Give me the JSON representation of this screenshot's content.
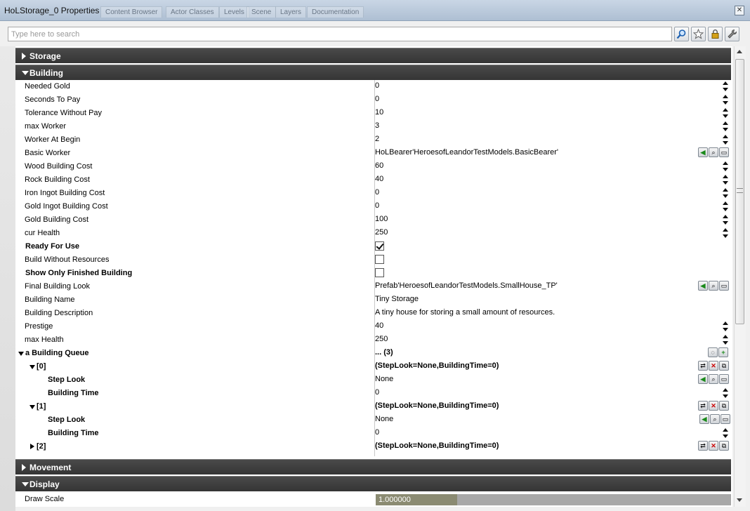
{
  "window": {
    "title": "HoLStorage_0 Properties",
    "background_tabs": [
      "Content Browser",
      "Actor Classes",
      "Levels",
      "Scene",
      "Layers",
      "Documentation"
    ]
  },
  "search": {
    "placeholder": "Type here to search"
  },
  "toolbar": {
    "icons": [
      "search-icon",
      "star-icon",
      "lock-icon",
      "wrench-icon"
    ]
  },
  "categories": {
    "storage": "Storage",
    "building": "Building",
    "movement": "Movement",
    "display": "Display"
  },
  "building": {
    "needed_gold": {
      "label": "Needed Gold",
      "value": "0"
    },
    "seconds_to_pay": {
      "label": "Seconds To Pay",
      "value": "0"
    },
    "tolerance_without_pay": {
      "label": "Tolerance Without Pay",
      "value": "10"
    },
    "max_worker": {
      "label": "max Worker",
      "value": "3"
    },
    "worker_at_begin": {
      "label": "Worker At Begin",
      "value": "2"
    },
    "basic_worker": {
      "label": "Basic Worker",
      "value": "HoLBearer'HeroesofLeandorTestModels.BasicBearer'"
    },
    "wood_building_cost": {
      "label": "Wood Building Cost",
      "value": "60"
    },
    "rock_building_cost": {
      "label": "Rock Building Cost",
      "value": "40"
    },
    "iron_ingot_building_cost": {
      "label": "Iron Ingot Building Cost",
      "value": "0"
    },
    "gold_ingot_building_cost": {
      "label": "Gold Ingot Building Cost",
      "value": "0"
    },
    "gold_building_cost": {
      "label": "Gold Building Cost",
      "value": "100"
    },
    "cur_health": {
      "label": "cur Health",
      "value": "250"
    },
    "ready_for_use": {
      "label": "Ready For Use",
      "checked": true
    },
    "build_without_resources": {
      "label": "Build Without Resources",
      "checked": false
    },
    "show_only_finished_building": {
      "label": "Show Only Finished Building",
      "checked": false
    },
    "final_building_look": {
      "label": "Final Building Look",
      "value": "Prefab'HeroesofLeandorTestModels.SmallHouse_TP'"
    },
    "building_name": {
      "label": "Building Name",
      "value": "Tiny Storage"
    },
    "building_description": {
      "label": "Building Description",
      "value": "A tiny house for storing a small amount of resources."
    },
    "prestige": {
      "label": "Prestige",
      "value": "40"
    },
    "max_health": {
      "label": "max Health",
      "value": "250"
    },
    "queue": {
      "label": "a Building Queue",
      "value": "... (3)",
      "items": [
        {
          "index": "[0]",
          "value": "(StepLook=None,BuildingTime=0)",
          "step_look_label": "Step Look",
          "step_look": "None",
          "building_time_label": "Building Time",
          "building_time": "0"
        },
        {
          "index": "[1]",
          "value": "(StepLook=None,BuildingTime=0)",
          "step_look_label": "Step Look",
          "step_look": "None",
          "building_time_label": "Building Time",
          "building_time": "0"
        },
        {
          "index": "[2]",
          "value": "(StepLook=None,BuildingTime=0)"
        }
      ]
    }
  },
  "display": {
    "draw_scale": {
      "label": "Draw Scale",
      "value": "1.000000",
      "fill_fraction": 0.23
    }
  }
}
